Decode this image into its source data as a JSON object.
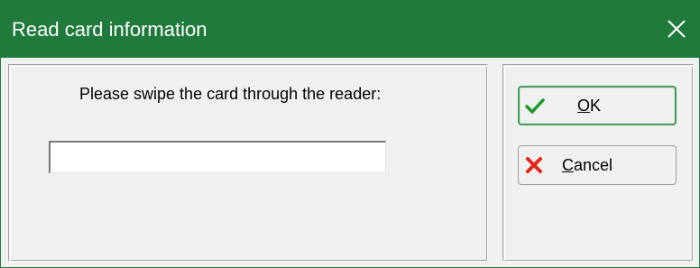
{
  "window": {
    "title": "Read card information",
    "close_icon": "close-icon",
    "titlebar_color": "#1f7a3c"
  },
  "form": {
    "prompt": "Please swipe the card through the reader:",
    "card_input": {
      "value": "",
      "placeholder": ""
    }
  },
  "buttons": {
    "ok": {
      "label": "OK",
      "icon": "checkmark-icon",
      "icon_color": "#1a9a2a",
      "default": true
    },
    "cancel": {
      "label": "Cancel",
      "icon": "x-mark-icon",
      "icon_color": "#e0281a"
    }
  }
}
